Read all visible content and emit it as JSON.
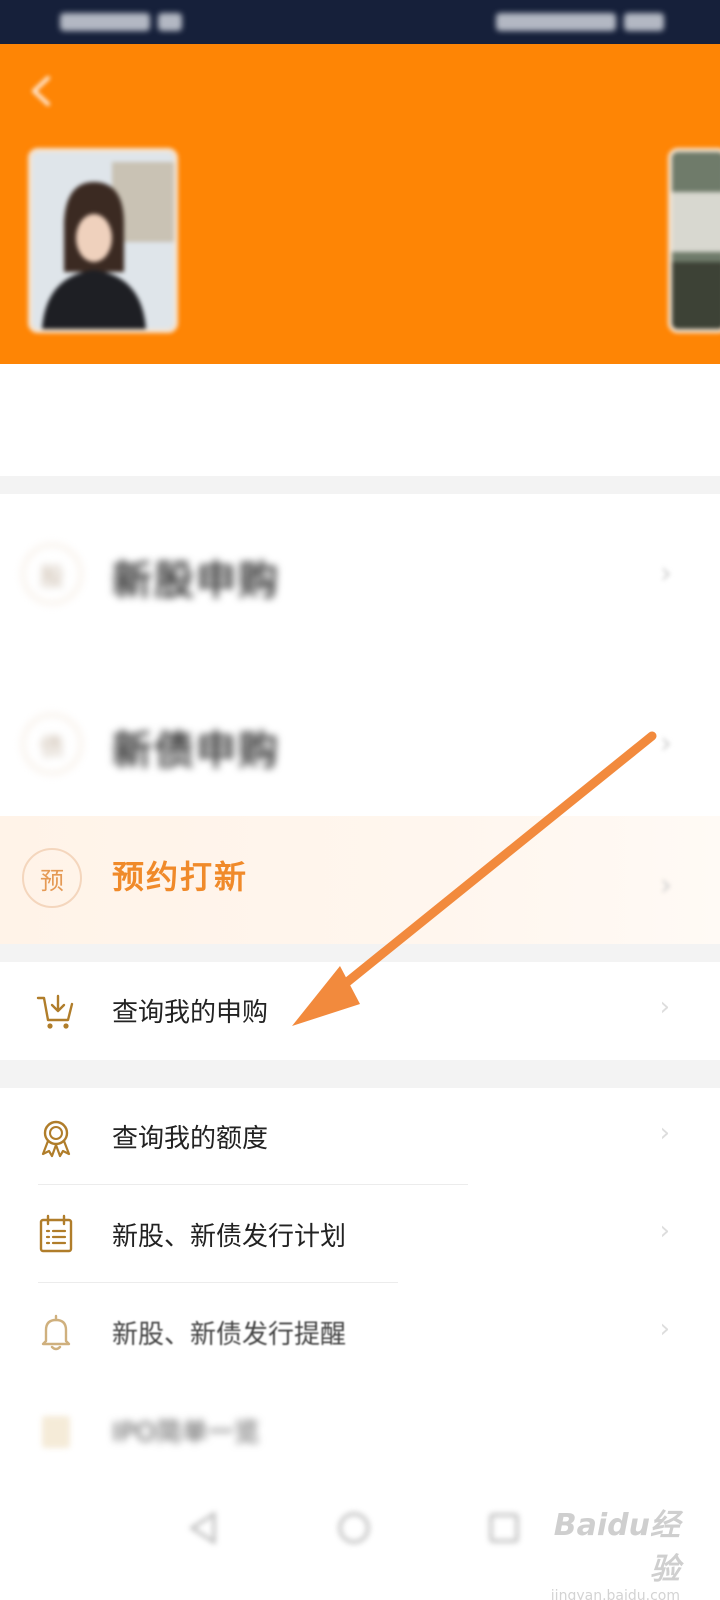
{
  "status_bar": {
    "left": "",
    "right": ""
  },
  "header": {
    "title": "",
    "banner": {
      "headline": "",
      "subtitle": ""
    }
  },
  "notice": {
    "text": ""
  },
  "features": [
    {
      "icon": "new-stock-icon",
      "label": "新股申购",
      "hint": "",
      "hint_accent": ""
    },
    {
      "icon": "new-bond-icon",
      "label": "新债申购",
      "hint": "",
      "hint_accent": ""
    },
    {
      "icon": "reserve-icon",
      "icon_text": "预",
      "label": "预约打新",
      "hint": ""
    }
  ],
  "query": {
    "label": "查询我的申购"
  },
  "list": [
    {
      "icon": "ribbon-badge-icon",
      "label": "查询我的额度"
    },
    {
      "icon": "calendar-icon",
      "label": "新股、新债发行计划"
    },
    {
      "icon": "bell-icon",
      "label": "新股、新债发行提醒",
      "extra": ""
    },
    {
      "icon": "clipboard-icon",
      "label": "IPO简单一览"
    }
  ],
  "watermark": {
    "logo": "Baidu经验",
    "sub": "jingyan.baidu.com"
  },
  "colors": {
    "brand": "#fe8505",
    "accent_text": "#f08a2a",
    "icon_gold": "#b8860b",
    "arrow": "#f28a3d"
  }
}
